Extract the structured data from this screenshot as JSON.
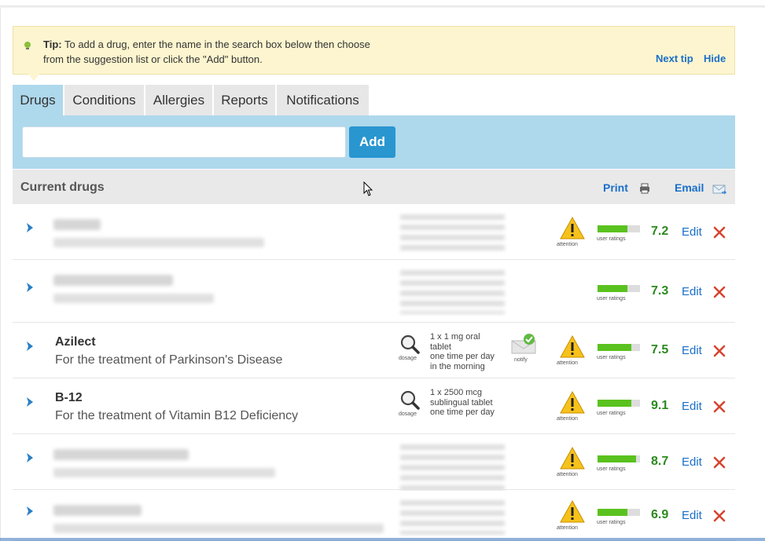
{
  "tip": {
    "label": "Tip:",
    "line1": "To add a drug, enter the name in the search box below then choose",
    "line2": "from the suggestion list or click the \"Add\" button.",
    "next": "Next tip",
    "hide": "Hide"
  },
  "tabs": [
    {
      "label": "Drugs",
      "active": true
    },
    {
      "label": "Conditions",
      "active": false
    },
    {
      "label": "Allergies",
      "active": false
    },
    {
      "label": "Reports",
      "active": false
    },
    {
      "label": "Notifications",
      "active": false
    }
  ],
  "search": {
    "value": "",
    "add_label": "Add"
  },
  "current": {
    "title": "Current drugs",
    "print": "Print",
    "email": "Email"
  },
  "common": {
    "edit": "Edit",
    "dosage": "dosage",
    "notify": "notify",
    "attention": "attention",
    "user_ratings": "user ratings"
  },
  "drugs": [
    {
      "name": "",
      "condition": "",
      "dosage": [],
      "rating": "7.2",
      "rating_fill": 0.7,
      "attention": true,
      "notify": false
    },
    {
      "name": "",
      "condition": "",
      "dosage": [],
      "rating": "7.3",
      "rating_fill": 0.7,
      "attention": false,
      "notify": false
    },
    {
      "name": "Azilect",
      "condition": "For the treatment of Parkinson's Disease",
      "dosage": [
        "1 x 1 mg oral",
        "tablet",
        "one time per day",
        "in the morning"
      ],
      "rating": "7.5",
      "rating_fill": 0.8,
      "attention": true,
      "notify": true
    },
    {
      "name": "B-12",
      "condition": "For the treatment of Vitamin B12 Deficiency",
      "dosage": [
        "1 x 2500 mcg",
        "sublingual tablet",
        "one time per day"
      ],
      "rating": "9.1",
      "rating_fill": 0.8,
      "attention": true,
      "notify": false
    },
    {
      "name": "",
      "condition": "",
      "dosage": [],
      "rating": "8.7",
      "rating_fill": 0.9,
      "attention": true,
      "notify": false
    },
    {
      "name": "",
      "condition": "",
      "dosage": [],
      "rating": "6.9",
      "rating_fill": 0.7,
      "attention": true,
      "notify": false
    }
  ],
  "colors": {
    "accent": "#2996d0",
    "link": "#1a6fc9",
    "rating": "#2b8a1e",
    "delete": "#d64530",
    "tip_bg": "#fcf5cf"
  }
}
